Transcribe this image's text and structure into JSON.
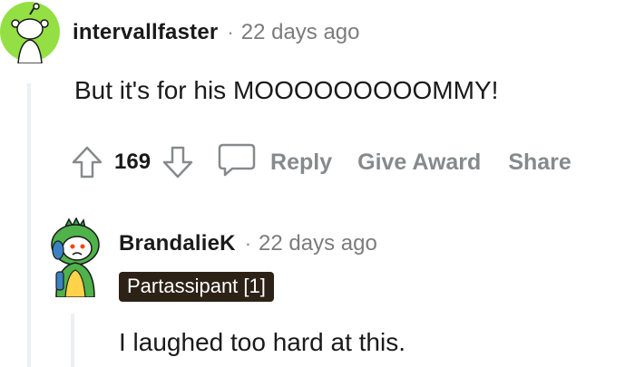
{
  "comments": [
    {
      "username": "intervallfaster",
      "separator": "·",
      "timestamp": "22 days ago",
      "body": "But it's for his MOOOOOOOOOMMY!",
      "votes": "169",
      "actions": {
        "reply": "Reply",
        "award": "Give Award",
        "share": "Share"
      },
      "avatar_icon": "snoo-avatar-green"
    },
    {
      "username": "BrandalieK",
      "separator": "·",
      "timestamp": "22 days ago",
      "flair": "Partassipant [1]",
      "body": "I laughed too hard at this.",
      "avatar_icon": "snoo-avatar-dino-hood"
    }
  ],
  "icons": {
    "upvote": "upvote-arrow-icon",
    "downvote": "downvote-arrow-icon",
    "reply": "comment-bubble-icon"
  },
  "colors": {
    "avatar_bg": "#94e044",
    "flair_bg": "#2d2216",
    "muted_text": "#878a8c",
    "thread_line": "#edeff1"
  }
}
